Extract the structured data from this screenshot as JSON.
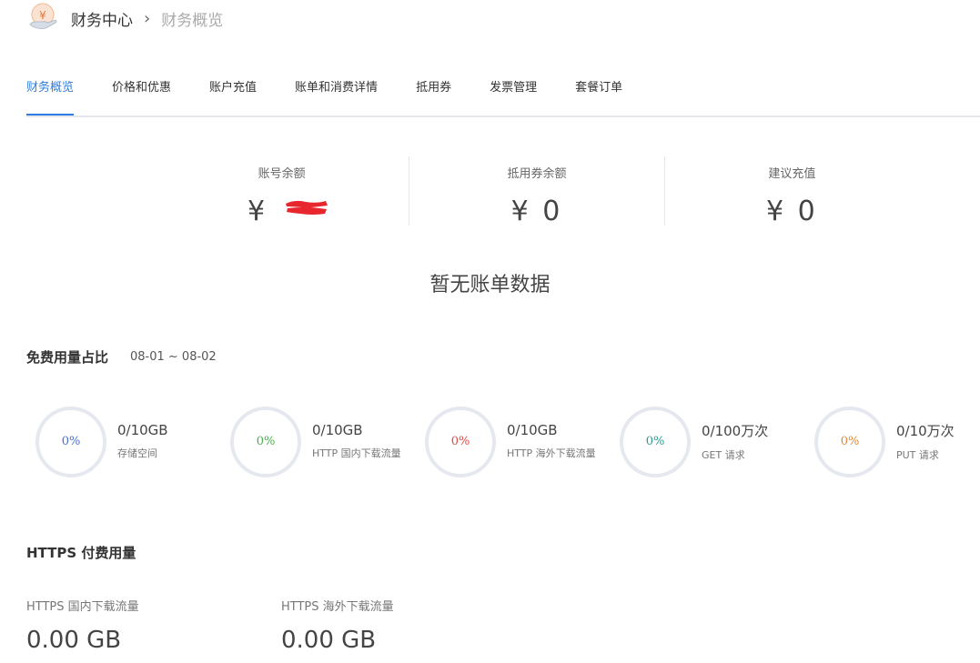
{
  "header": {
    "logo_icon": "yen-coin-icon",
    "breadcrumb_root": "财务中心",
    "breadcrumb_current": "财务概览"
  },
  "tabs": [
    {
      "label": "财务概览",
      "active": true
    },
    {
      "label": "价格和优惠"
    },
    {
      "label": "账户充值"
    },
    {
      "label": "账单和消费详情"
    },
    {
      "label": "抵用券"
    },
    {
      "label": "发票管理"
    },
    {
      "label": "套餐订单"
    }
  ],
  "balances": [
    {
      "label": "账号余额",
      "currency": "¥",
      "value": ""
    },
    {
      "label": "抵用券余额",
      "currency": "¥",
      "value": "0"
    },
    {
      "label": "建议充值",
      "currency": "¥",
      "value": "0"
    }
  ],
  "bill_empty_text": "暂无账单数据",
  "free_usage": {
    "title": "免费用量占比",
    "range": "08-01 ~ 08-02",
    "items": [
      {
        "percent": "0%",
        "amount": "0/10GB",
        "label": "存储空间",
        "color": "#4a6fd0"
      },
      {
        "percent": "0%",
        "amount": "0/10GB",
        "label": "HTTP 国内下载流量",
        "color": "#4caf50"
      },
      {
        "percent": "0%",
        "amount": "0/10GB",
        "label": "HTTP 海外下载流量",
        "color": "#e04a4a"
      },
      {
        "percent": "0%",
        "amount": "0/100万次",
        "label": "GET 请求",
        "color": "#2a9d8f"
      },
      {
        "percent": "0%",
        "amount": "0/10万次",
        "label": "PUT 请求",
        "color": "#e08a3a"
      }
    ]
  },
  "https_paid": {
    "title": "HTTPS 付费用量",
    "items": [
      {
        "label": "HTTPS 国内下载流量",
        "value": "0.00 GB"
      },
      {
        "label": "HTTPS 海外下载流量",
        "value": "0.00 GB"
      }
    ]
  },
  "colors": {
    "accent": "#2e7de1",
    "ring_track": "#e5e8ef",
    "redaction": "#e8262d"
  }
}
